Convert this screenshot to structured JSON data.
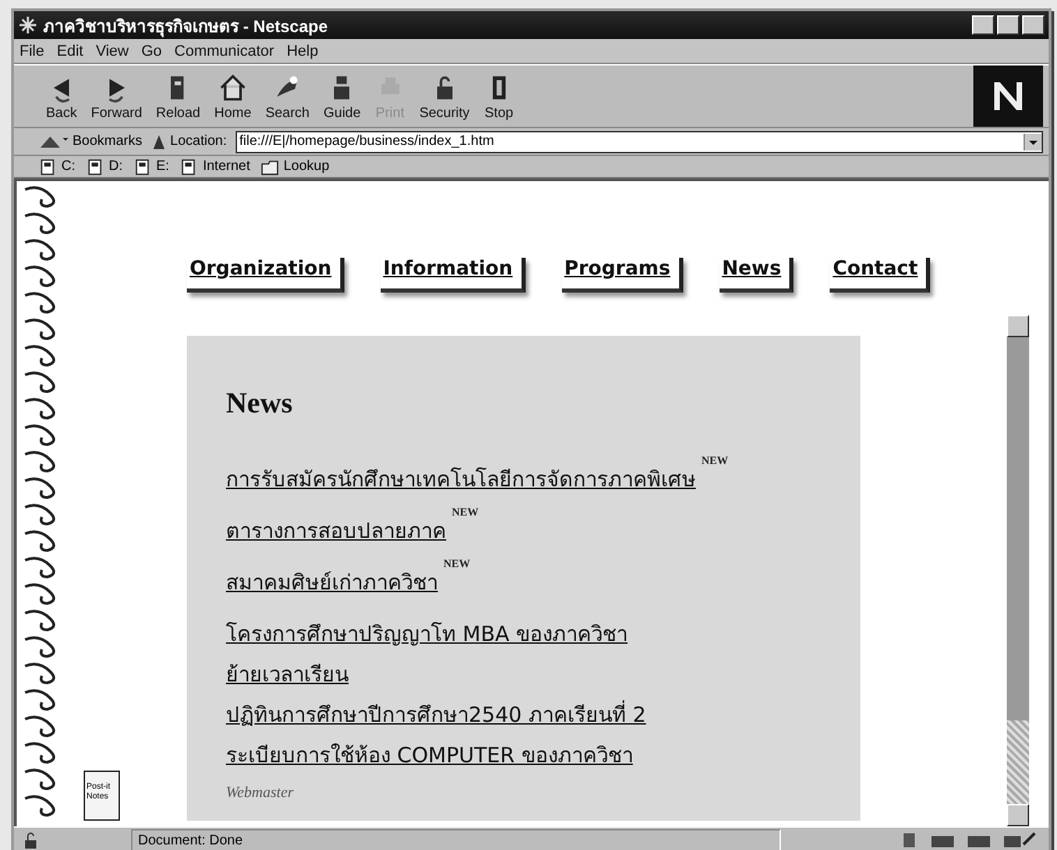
{
  "window": {
    "title": "ภาควิชาบริหารธุรกิจเกษตร - Netscape"
  },
  "menu": [
    "File",
    "Edit",
    "View",
    "Go",
    "Communicator",
    "Help"
  ],
  "toolbar": [
    {
      "label": "Back",
      "kind": "back",
      "disabled": false
    },
    {
      "label": "Forward",
      "kind": "forward",
      "disabled": false
    },
    {
      "label": "Reload",
      "kind": "reload",
      "disabled": false
    },
    {
      "label": "Home",
      "kind": "home",
      "disabled": false
    },
    {
      "label": "Search",
      "kind": "search",
      "disabled": false
    },
    {
      "label": "Guide",
      "kind": "guide",
      "disabled": false
    },
    {
      "label": "Print",
      "kind": "print",
      "disabled": true
    },
    {
      "label": "Security",
      "kind": "security",
      "disabled": false
    },
    {
      "label": "Stop",
      "kind": "stop",
      "disabled": false
    }
  ],
  "location": {
    "bookmarks_label": "Bookmarks",
    "label": "Location:",
    "value": "file:///E|/homepage/business/index_1.htm"
  },
  "personal_toolbar": [
    {
      "label": "C:",
      "kind": "page"
    },
    {
      "label": "D:",
      "kind": "page"
    },
    {
      "label": "E:",
      "kind": "page"
    },
    {
      "label": "Internet",
      "kind": "page"
    },
    {
      "label": "Lookup",
      "kind": "folder"
    }
  ],
  "nav": [
    "Organization",
    "Information",
    "Programs",
    "News",
    "Contact"
  ],
  "news": {
    "heading": "News",
    "items": [
      {
        "text": "การรับสมัครนักศึกษาเทคโนโลยีการจัดการภาคพิเศษ",
        "badge": "NEW"
      },
      {
        "text": "ตารางการสอบปลายภาค",
        "badge": "NEW"
      },
      {
        "text": "สมาคมศิษย์เก่าภาควิชา",
        "badge": "NEW"
      },
      {
        "text": "โครงการศึกษาปริญญาโท MBA ของภาควิชา"
      },
      {
        "text": "ย้ายเวลาเรียน"
      },
      {
        "text": "ปฏิทินการศึกษาปีการศึกษา2540 ภาคเรียนที่ 2"
      },
      {
        "text": "ระเบียบการใช้ห้อง COMPUTER ของภาควิชา"
      }
    ],
    "footer": "Webmaster"
  },
  "postit": "Post-it Notes",
  "status_bar": {
    "text": "Document: Done"
  }
}
